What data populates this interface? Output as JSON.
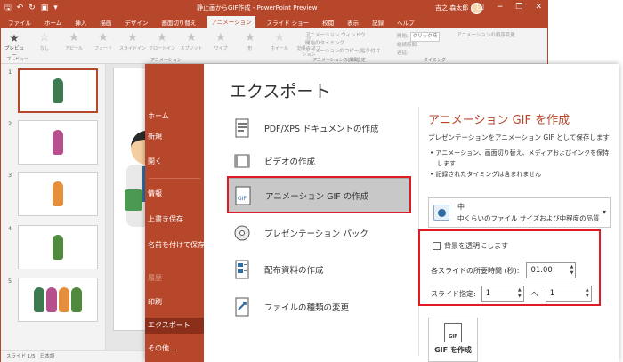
{
  "titlebar": {
    "title": "静止画からGIF作成 - PowerPoint Preview",
    "user": "吉之 森太郎",
    "minimize_icon": "minimize-icon",
    "restore_icon": "restore-icon",
    "close_icon": "close-icon"
  },
  "ribbon_tabs": [
    "ファイル",
    "ホーム",
    "挿入",
    "描画",
    "デザイン",
    "画面切り替え",
    "アニメーション",
    "スライド ショー",
    "校閲",
    "表示",
    "記録",
    "ヘルプ"
  ],
  "ribbon": {
    "preview_label": "プレビュー",
    "preview_group": "プレビュー",
    "animations": [
      "なし",
      "アピール",
      "フェード",
      "スライドイン",
      "フロートイン",
      "スプリット",
      "ワイプ",
      "形",
      "ホイール"
    ],
    "effect_options": "効果の\nオプション",
    "animation_group": "アニメーション",
    "add_animation": "アニメーション\nの追加",
    "animation_pane": "アニメーション ウィンドウ",
    "trigger": "開始のタイミング",
    "animation_painter": "アニメーションのコピー/貼り付け",
    "advanced_group": "アニメーションの詳細設定",
    "start_label": "開始:",
    "start_value": "クリック時",
    "duration_label": "継続時間:",
    "delay_label": "遅延:",
    "timing_group": "タイミング",
    "reorder_title": "アニメーションの順序変更"
  },
  "thumbnails": [
    "1",
    "2",
    "3",
    "4",
    "5"
  ],
  "status": {
    "slide": "スライド 1/5",
    "language": "日本語"
  },
  "backstage": {
    "nav": [
      {
        "label": "ホーム",
        "state": "normal"
      },
      {
        "label": "新規",
        "state": "normal"
      },
      {
        "label": "開く",
        "state": "normal"
      },
      {
        "label": "情報",
        "state": "normal"
      },
      {
        "label": "上書き保存",
        "state": "normal"
      },
      {
        "label": "名前を付けて保存",
        "state": "normal"
      },
      {
        "label": "履歴",
        "state": "disabled"
      },
      {
        "label": "印刷",
        "state": "normal"
      },
      {
        "label": "エクスポート",
        "state": "active"
      },
      {
        "label": "その他...",
        "state": "normal"
      }
    ],
    "title": "エクスポート",
    "export_options": [
      {
        "label": "PDF/XPS ドキュメントの作成",
        "icon": "pdf-icon"
      },
      {
        "label": "ビデオの作成",
        "icon": "video-icon"
      },
      {
        "label": "アニメーション GIF の作成",
        "icon": "gif-icon"
      },
      {
        "label": "プレゼンテーション パック",
        "icon": "cd-icon"
      },
      {
        "label": "配布資料の作成",
        "icon": "handout-icon"
      },
      {
        "label": "ファイルの種類の変更",
        "icon": "change-filetype-icon"
      }
    ],
    "detail": {
      "title": "アニメーション GIF を作成",
      "subtitle": "プレゼンテーションをアニメーション GIF として保存します",
      "bullets": [
        "アニメーション、画面切り替え、メディアおよびインクを保持します",
        "記録されたタイミングは含まれません"
      ],
      "quality_name": "中",
      "quality_desc": "中くらいのファイル サイズおよび中程度の品質",
      "transparent_label": "背景を透明にします",
      "duration_label": "各スライドの所要時間 (秒):",
      "duration_value": "01.00",
      "range_label": "スライド指定:",
      "range_from": "1",
      "range_sep": "へ",
      "range_to": "1",
      "create_button": "GIF を作成"
    }
  },
  "colors": {
    "accent": "#b7472a",
    "highlight": "#e01b24"
  }
}
